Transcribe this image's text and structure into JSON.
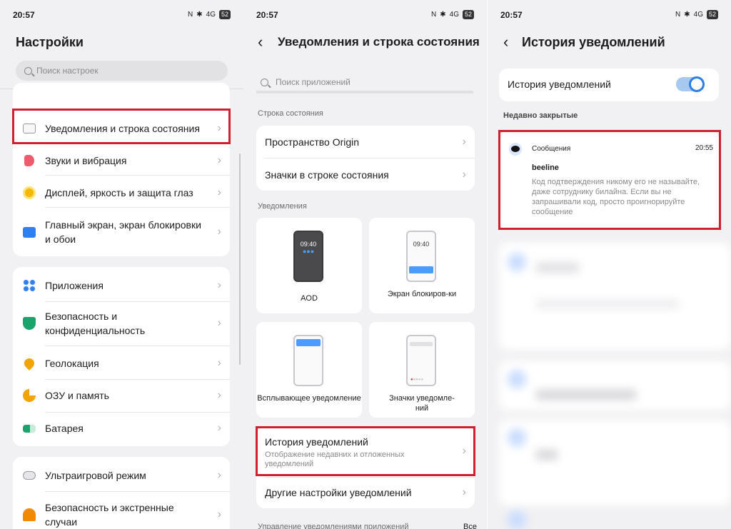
{
  "status": {
    "time": "20:57",
    "battery": "52",
    "net": "4G"
  },
  "panel1": {
    "title": "Настройки",
    "search_placeholder": "Поиск настроек",
    "items": [
      {
        "label": "Уведомления и строка состояния"
      },
      {
        "label": "Звуки и вибрация"
      },
      {
        "label": "Дисплей, яркость и защита глаз"
      },
      {
        "label": "Главный экран, экран блокировки и обои"
      },
      {
        "label": "Приложения"
      },
      {
        "label": "Безопасность и конфиденциальность"
      },
      {
        "label": "Геолокация"
      },
      {
        "label": "ОЗУ и память"
      },
      {
        "label": "Батарея"
      },
      {
        "label": "Ультраигровой режим"
      },
      {
        "label": "Безопасность и экстренные случаи"
      }
    ]
  },
  "panel2": {
    "title": "Уведомления и строка состояния",
    "search_placeholder": "Поиск приложений",
    "section_status": "Строка состояния",
    "status_items": [
      "Пространство Origin",
      "Значки в строке состояния"
    ],
    "section_notifications": "Уведомления",
    "tiles": [
      {
        "label": "AOD",
        "clock": "09:40"
      },
      {
        "label": "Экран блокиров-ки",
        "clock": "09:40"
      },
      {
        "label": "Всплывающее уведомление"
      },
      {
        "label": "Значки уведомле-ний"
      }
    ],
    "history_title": "История уведомлений",
    "history_sub": "Отображение недавних и отложенных уведомлений",
    "other_settings": "Другие настройки уведомлений",
    "app_mgmt": "Управление уведомлениями приложений",
    "app_mgmt_value": "Все"
  },
  "panel3": {
    "title": "История уведомлений",
    "toggle_label": "История уведомлений",
    "toggle_on": true,
    "recent_label": "Недавно закрытые",
    "notif": {
      "app": "Сообщения",
      "time": "20:55",
      "sender": "beeline",
      "text": "Код подтверждения никому его не называйте, даже сотруднику билайна. Если вы не запрашивали код, просто проигнорируйте сообщение"
    }
  },
  "colors": {
    "highlight": "#d0202f",
    "accent": "#2d7fe3",
    "background": "#f1f1f3"
  }
}
